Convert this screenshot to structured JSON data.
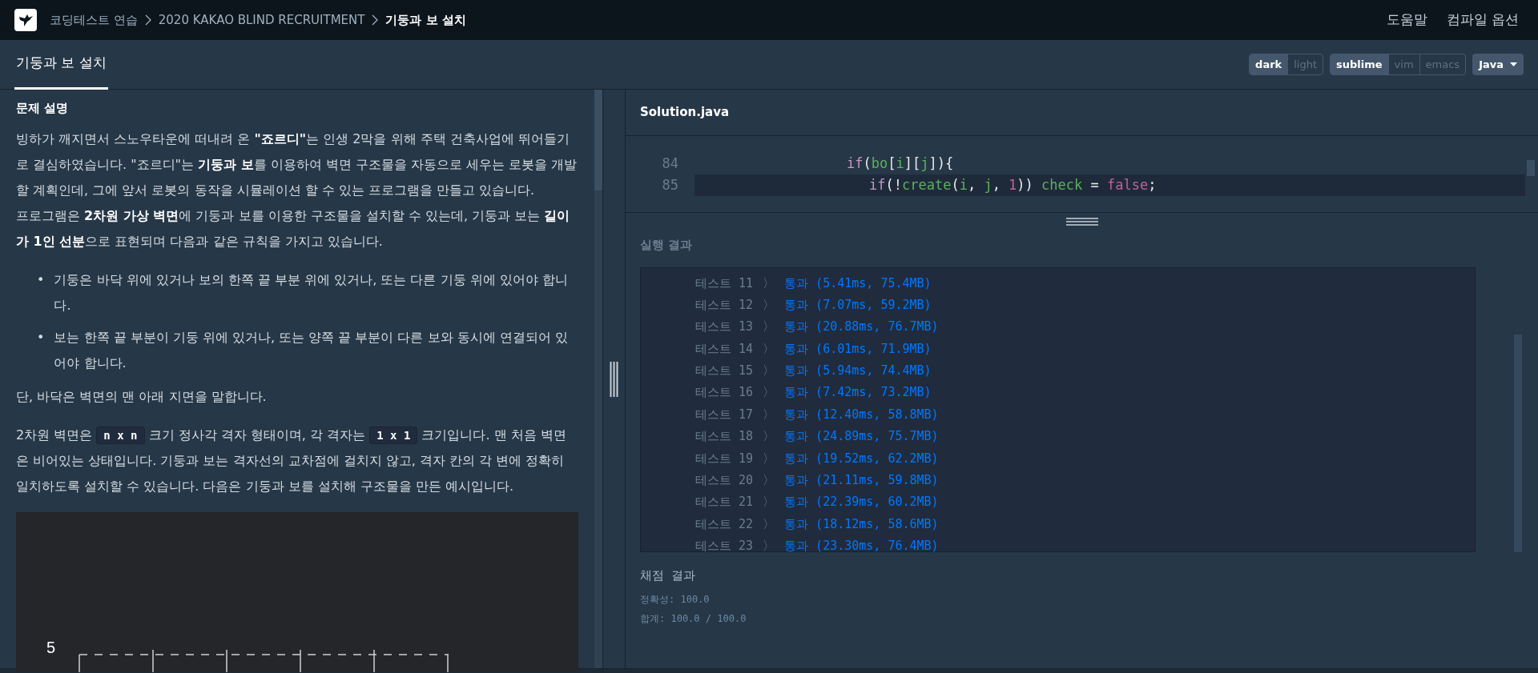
{
  "breadcrumb": [
    {
      "label": "코딩테스트 연습"
    },
    {
      "label": "2020 KAKAO BLIND RECRUITMENT"
    },
    {
      "label": "기둥과 보 설치",
      "current": true
    }
  ],
  "top_links": [
    "도움말",
    "컴파일 옵션"
  ],
  "problem_tab": {
    "label": "기둥과 보 설치",
    "selected": true
  },
  "theme_toggle": [
    {
      "label": "dark",
      "selected": true
    },
    {
      "label": "light",
      "selected": false
    }
  ],
  "keymap_toggle": [
    {
      "label": "sublime",
      "selected": true
    },
    {
      "label": "vim",
      "selected": false
    },
    {
      "label": "emacs",
      "selected": false
    }
  ],
  "language": "Java",
  "description": {
    "heading": "문제 설명",
    "paragraphs": [
      "빙하가 깨지면서 스노우타운에 떠내려 온 **\"죠르디\"**는 인생 2막을 위해 주택 건축사업에 뛰어들기로 결심하였습니다. \"죠르디\"는 **기둥과 보**를 이용하여 벽면 구조물을 자동으로 세우는 로봇을 개발할 계획인데, 그에 앞서 로봇의 동작을 시뮬레이션 할 수 있는 프로그램을 만들고 있습니다.",
      "프로그램은 **2차원 가상 벽면**에 기둥과 보를 이용한 구조물을 설치할 수 있는데, 기둥과 보는 **길이가 1인 선분**으로 표현되며 다음과 같은 규칙을 가지고 있습니다."
    ],
    "rules": [
      {
        "bullet": "•",
        "text": "기둥은 바닥 위에 있거나 보의 한쪽 끝 부분 위에 있거나, 또는 다른 기둥 위에 있어야 합니다."
      },
      {
        "bullet": "•",
        "text": "보는 한쪽 끝 부분이 기둥 위에 있거나, 또는 양쪽 끝 부분이 다른 보와 동시에 연결되어 있어야 합니다."
      }
    ],
    "note": "단, 바닥은 벽면의 맨 아래 지면을 말합니다.",
    "grid_paragraph": [
      {
        "kind": "text",
        "text": "2차원 벽면은 "
      },
      {
        "kind": "code",
        "text": "n x n"
      },
      {
        "kind": "text",
        "text": " 크기 정사각 격자 형태이며, 각 격자는 "
      },
      {
        "kind": "code",
        "text": "1 x 1"
      },
      {
        "kind": "text",
        "text": " 크기입니다. 맨 처음 벽면은 비어있는 상태입니다. 기둥과 보는 격자선의 교차점에 걸치지 않고, 격자 칸의 각 변에 정확히 일치하도록 설치할 수 있습니다. 다음은 기둥과 보를 설치해 구조물을 만든 예시입니다."
      }
    ],
    "figure_label": "5"
  },
  "editor": {
    "filename": "Solution.java",
    "lines": [
      {
        "number": "84",
        "kind": "outer",
        "active": false,
        "tokens": [
          {
            "kind": "keyword",
            "text": "if"
          },
          {
            "kind": "plain",
            "text": "("
          },
          {
            "kind": "variable",
            "text": "bo"
          },
          {
            "kind": "plain",
            "text": "["
          },
          {
            "kind": "variable",
            "text": "i"
          },
          {
            "kind": "plain",
            "text": "]["
          },
          {
            "kind": "variable",
            "text": "j"
          },
          {
            "kind": "plain",
            "text": "]){"
          }
        ]
      },
      {
        "number": "85",
        "kind": "inner",
        "active": true,
        "tokens": [
          {
            "kind": "keyword",
            "text": "if"
          },
          {
            "kind": "plain",
            "text": "(!"
          },
          {
            "kind": "function",
            "text": "create"
          },
          {
            "kind": "plain",
            "text": "("
          },
          {
            "kind": "variable",
            "text": "i"
          },
          {
            "kind": "plain",
            "text": ", "
          },
          {
            "kind": "variable",
            "text": "j"
          },
          {
            "kind": "plain",
            "text": ", "
          },
          {
            "kind": "literal",
            "text": "1"
          },
          {
            "kind": "plain",
            "text": ")) "
          },
          {
            "kind": "variable",
            "text": "check"
          },
          {
            "kind": "plain",
            "text": " = "
          },
          {
            "kind": "literal",
            "text": "false"
          },
          {
            "kind": "plain",
            "text": ";"
          }
        ]
      }
    ]
  },
  "results": {
    "heading": "실행 결과",
    "tests": [
      {
        "label": "테스트 11",
        "arrow": "〉",
        "result": "통과 (5.41ms, 75.4MB)"
      },
      {
        "label": "테스트 12",
        "arrow": "〉",
        "result": "통과 (7.07ms, 59.2MB)"
      },
      {
        "label": "테스트 13",
        "arrow": "〉",
        "result": "통과 (20.88ms, 76.7MB)"
      },
      {
        "label": "테스트 14",
        "arrow": "〉",
        "result": "통과 (6.01ms, 71.9MB)"
      },
      {
        "label": "테스트 15",
        "arrow": "〉",
        "result": "통과 (5.94ms, 74.4MB)"
      },
      {
        "label": "테스트 16",
        "arrow": "〉",
        "result": "통과 (7.42ms, 73.2MB)"
      },
      {
        "label": "테스트 17",
        "arrow": "〉",
        "result": "통과 (12.40ms, 58.8MB)"
      },
      {
        "label": "테스트 18",
        "arrow": "〉",
        "result": "통과 (24.89ms, 75.7MB)"
      },
      {
        "label": "테스트 19",
        "arrow": "〉",
        "result": "통과 (19.52ms, 62.2MB)"
      },
      {
        "label": "테스트 20",
        "arrow": "〉",
        "result": "통과 (21.11ms, 59.8MB)"
      },
      {
        "label": "테스트 21",
        "arrow": "〉",
        "result": "통과 (22.39ms, 60.2MB)"
      },
      {
        "label": "테스트 22",
        "arrow": "〉",
        "result": "통과 (18.12ms, 58.6MB)"
      },
      {
        "label": "테스트 23",
        "arrow": "〉",
        "result": "통과 (23.30ms, 76.4MB)"
      }
    ],
    "grading_heading": "채점 결과",
    "accuracy": "정확성: 100.0",
    "total": "합계: 100.0 / 100.0"
  }
}
